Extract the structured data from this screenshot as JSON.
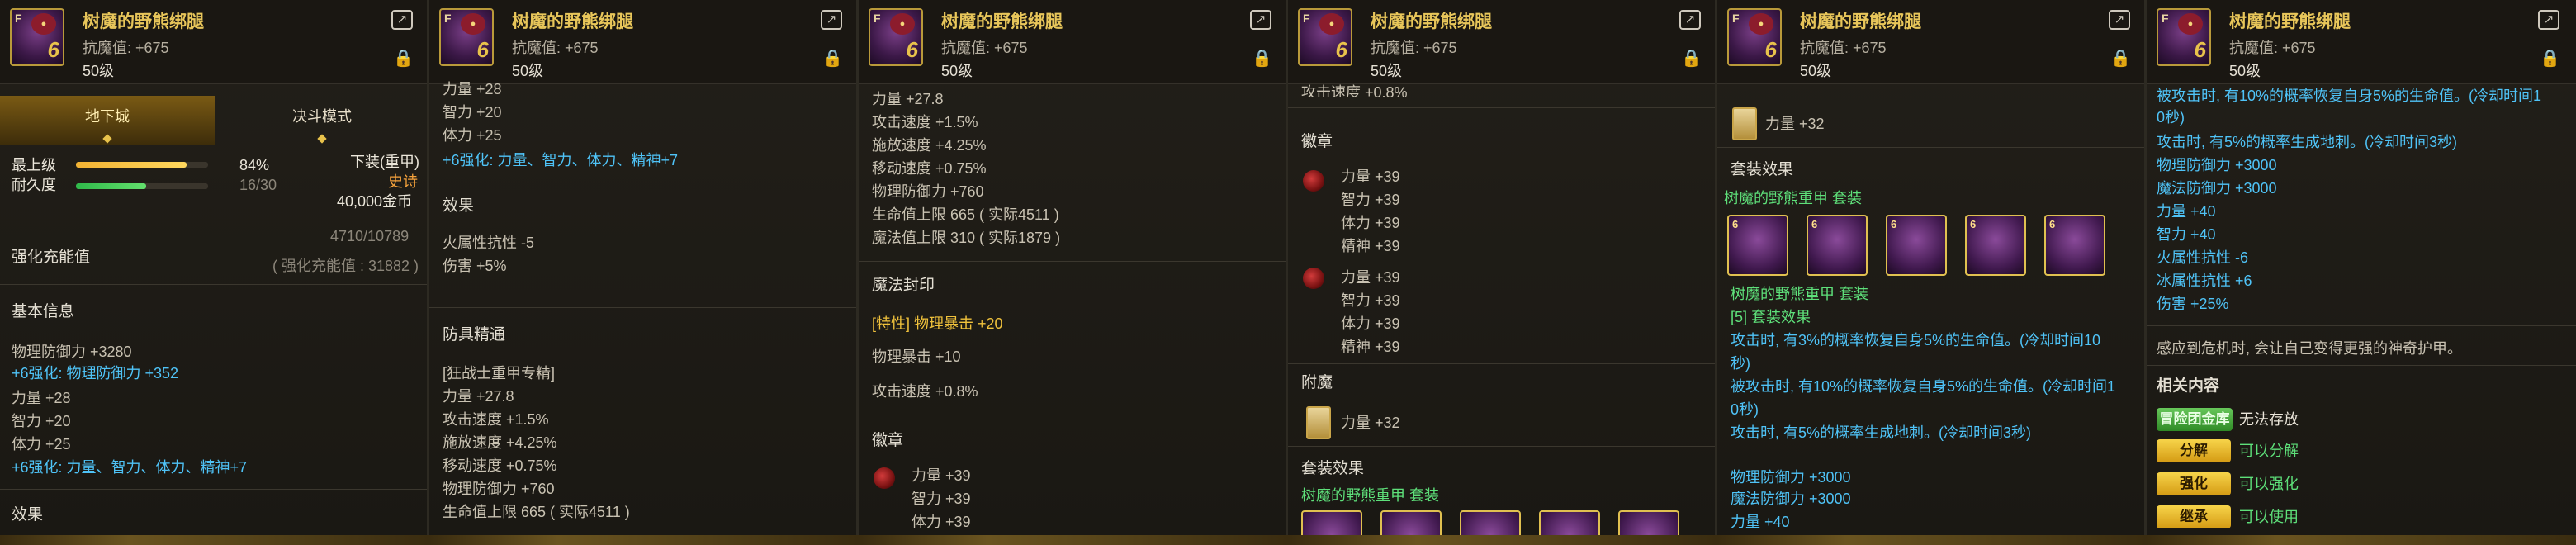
{
  "item": {
    "name": "树魔的野熊绑腿",
    "resist": "抗魔值: +675",
    "level": "50级",
    "grade": "F",
    "enhance": "6"
  },
  "p1": {
    "tab_dungeon": "地下城",
    "tab_pvp": "决斗模式",
    "top_level_label": "最上级",
    "top_level_pct": "84%",
    "top_level_fill": 0.84,
    "durability_label": "耐久度",
    "durability_val": "16/30",
    "durability_fill": 0.53,
    "slot": "下装(重甲)",
    "rarity": "史诗",
    "price": "40,000金币",
    "charge_label": "强化充能值",
    "charge_val": "4710/10789",
    "charge_note": "( 强化充能值 : 31882 )",
    "basic_info": "基本信息",
    "phys_def": "物理防御力 +3280",
    "plus6_def": "+6强化: 物理防御力 +352",
    "str": "力量 +28",
    "int": "智力 +20",
    "vit": "体力 +25",
    "plus6_stats": "+6强化: 力量、智力、体力、精神+7",
    "effect": "效果"
  },
  "p2": {
    "str": "力量 +28",
    "int": "智力 +20",
    "vit": "体力 +25",
    "plus6_stats": "+6强化: 力量、智力、体力、精神+7",
    "effect": "效果",
    "fire_res": "火属性抗性 -5",
    "dmg": "伤害 +5%",
    "mastery": "防具精通",
    "mastery_class": "[狂战士重甲专精]",
    "m_str": "力量 +27.8",
    "m_atk_spd": "攻击速度 +1.5%",
    "m_cast_spd": "施放速度 +4.25%",
    "m_move_spd": "移动速度 +0.75%",
    "m_phys_def": "物理防御力 +760",
    "m_hp": "生命值上限 665 ( 实际4511 )"
  },
  "p3": {
    "str": "力量 +27.8",
    "atk_spd": "攻击速度 +1.5%",
    "cast_spd": "施放速度 +4.25%",
    "move_spd": "移动速度 +0.75%",
    "phys_def": "物理防御力 +760",
    "hp": "生命值上限 665 ( 实际4511 )",
    "mp": "魔法值上限 310 ( 实际1879 )",
    "seal": "魔法封印",
    "seal_trait": "[特性] 物理暴击 +20",
    "seal_crit": "物理暴击 +10",
    "seal_atk": "攻击速度 +0.8%",
    "emblem": "徽章",
    "e_str": "力量 +39",
    "e_int": "智力 +39",
    "e_vit": "体力 +39"
  },
  "p4": {
    "atk_spd": "攻击速度 +0.8%",
    "emblem": "徽章",
    "e1_str": "力量 +39",
    "e1_int": "智力 +39",
    "e1_vit": "体力 +39",
    "e1_spi": "精神 +39",
    "e2_str": "力量 +39",
    "e2_int": "智力 +39",
    "e2_vit": "体力 +39",
    "e2_spi": "精神 +39",
    "enchant": "附魔",
    "enchant_str": "力量 +32",
    "set_effect": "套装效果",
    "set_name": "树魔的野熊重甲  套装"
  },
  "p5": {
    "enchant_str": "力量 +32",
    "set_effect": "套装效果",
    "set_name": "树魔的野熊重甲  套装",
    "set_icons": [
      "6",
      "6",
      "6",
      "6",
      "6"
    ],
    "set_name2": "树魔的野熊重甲  套装",
    "set5": "[5] 套装效果",
    "s1a": "攻击时, 有3%的概率恢复自身5%的生命值。(冷却时间10",
    "s1b": "秒)",
    "s2a": "被攻击时, 有10%的概率恢复自身5%的生命值。(冷却时间1",
    "s2b": "0秒)",
    "s3": "攻击时, 有5%的概率生成地刺。(冷却时间3秒)",
    "s_phys": "物理防御力 +3000",
    "s_mag": "魔法防御力 +3000",
    "s_str": "力量 +40"
  },
  "p6": {
    "r1": "被攻击时, 有10%的概率恢复自身5%的生命值。(冷却时间1",
    "r2": "0秒)",
    "r3": "攻击时, 有5%的概率生成地刺。(冷却时间3秒)",
    "phys": "物理防御力 +3000",
    "mag": "魔法防御力 +3000",
    "str": "力量 +40",
    "int": "智力 +40",
    "fire": "火属性抗性 -6",
    "ice": "冰属性抗性 +6",
    "dmg": "伤害 +25%",
    "flavor": "感应到危机时, 会让自己变得更强的神奇护甲。",
    "related": "相关内容",
    "guild_tag": "冒险团金库",
    "guild_val": "无法存放",
    "b1": "分解",
    "b1v": "可以分解",
    "b2": "强化",
    "b2v": "可以强化",
    "b3": "继承",
    "b3v": "可以使用"
  },
  "colors": {
    "title": "#e8c65a",
    "blue": "#4fc3f7",
    "green": "#5ee07a",
    "gold": "#f0c23c",
    "epic": "#f5a23c"
  }
}
